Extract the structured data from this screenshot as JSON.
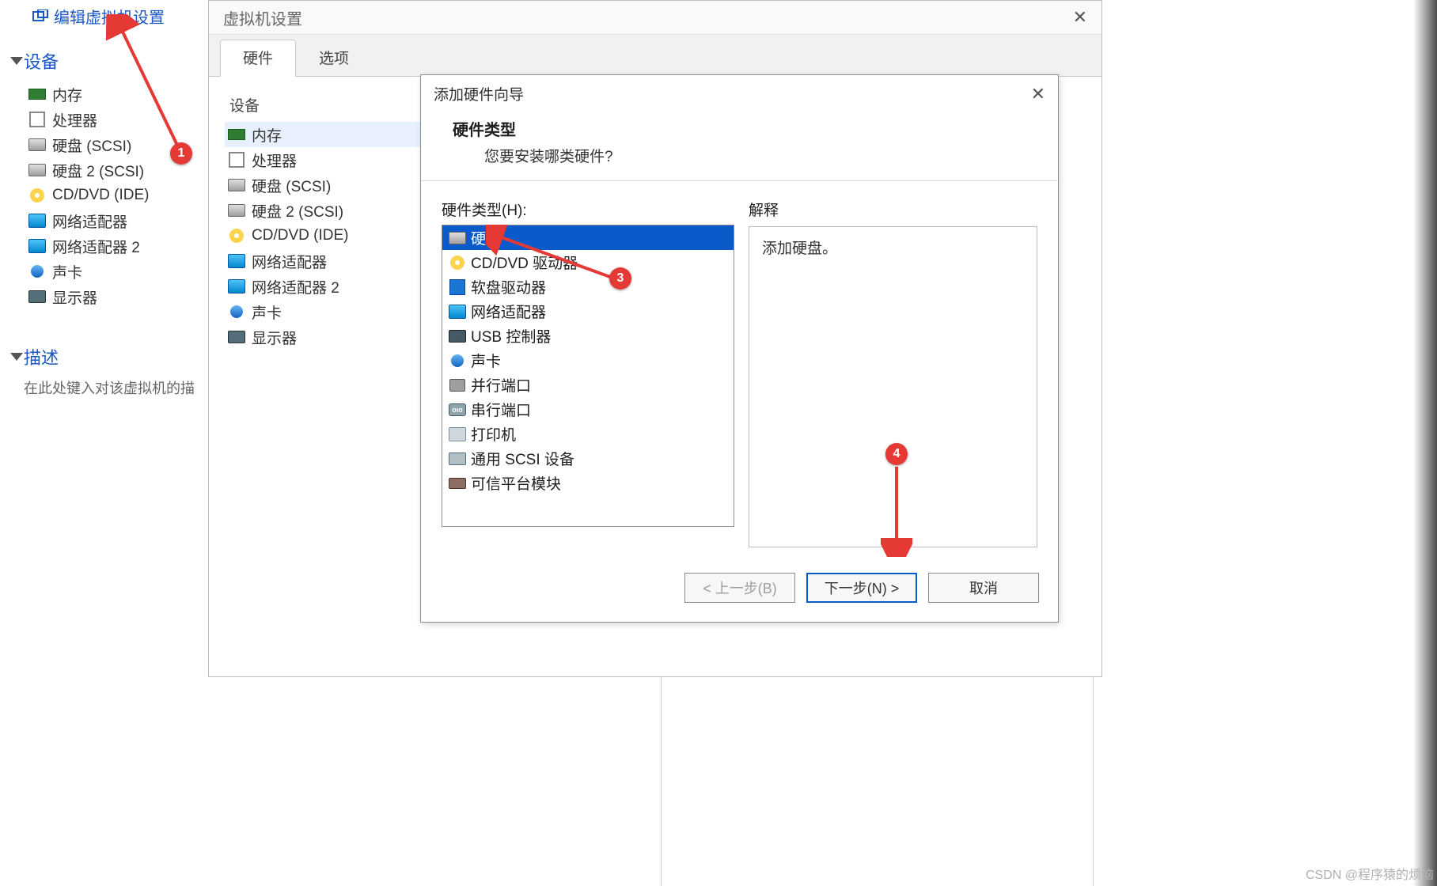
{
  "left": {
    "edit_link": "编辑虚拟机设置",
    "devices_header": "设备",
    "devices": [
      {
        "label": "内存"
      },
      {
        "label": "处理器"
      },
      {
        "label": "硬盘 (SCSI)"
      },
      {
        "label": "硬盘 2 (SCSI)"
      },
      {
        "label": "CD/DVD (IDE)"
      },
      {
        "label": "网络适配器"
      },
      {
        "label": "网络适配器 2"
      },
      {
        "label": "声卡"
      },
      {
        "label": "显示器"
      }
    ],
    "desc_header": "描述",
    "desc_placeholder": "在此处键入对该虚拟机的描"
  },
  "settings_dialog": {
    "title": "虚拟机设置",
    "tabs": [
      {
        "label": "硬件",
        "active": true
      },
      {
        "label": "选项",
        "active": false
      }
    ],
    "device_col_header": "设备",
    "devices": [
      {
        "label": "内存",
        "selected": true
      },
      {
        "label": "处理器"
      },
      {
        "label": "硬盘 (SCSI)"
      },
      {
        "label": "硬盘 2 (SCSI)"
      },
      {
        "label": "CD/DVD (IDE)"
      },
      {
        "label": "网络适配器"
      },
      {
        "label": "网络适配器 2"
      },
      {
        "label": "声卡"
      },
      {
        "label": "显示器"
      }
    ]
  },
  "wizard": {
    "title": "添加硬件向导",
    "banner_title": "硬件类型",
    "banner_sub": "您要安装哪类硬件?",
    "hw_label": "硬件类型(H):",
    "hw_items": [
      {
        "label": "硬盘",
        "selected": true,
        "icon": "hdd"
      },
      {
        "label": "CD/DVD 驱动器",
        "icon": "cd"
      },
      {
        "label": "软盘驱动器",
        "icon": "floppy"
      },
      {
        "label": "网络适配器",
        "icon": "net"
      },
      {
        "label": "USB 控制器",
        "icon": "usb"
      },
      {
        "label": "声卡",
        "icon": "sound"
      },
      {
        "label": "并行端口",
        "icon": "parallel"
      },
      {
        "label": "串行端口",
        "icon": "serial"
      },
      {
        "label": "打印机",
        "icon": "printer"
      },
      {
        "label": "通用 SCSI 设备",
        "icon": "scsi"
      },
      {
        "label": "可信平台模块",
        "icon": "tpm"
      }
    ],
    "explain_label": "解释",
    "explain_text": "添加硬盘。",
    "buttons": {
      "back": "< 上一步(B)",
      "next": "下一步(N) >",
      "cancel": "取消"
    }
  },
  "markers": {
    "m1": "1",
    "m3": "3",
    "m4": "4"
  },
  "watermark": "CSDN @程序猿的烦恼"
}
